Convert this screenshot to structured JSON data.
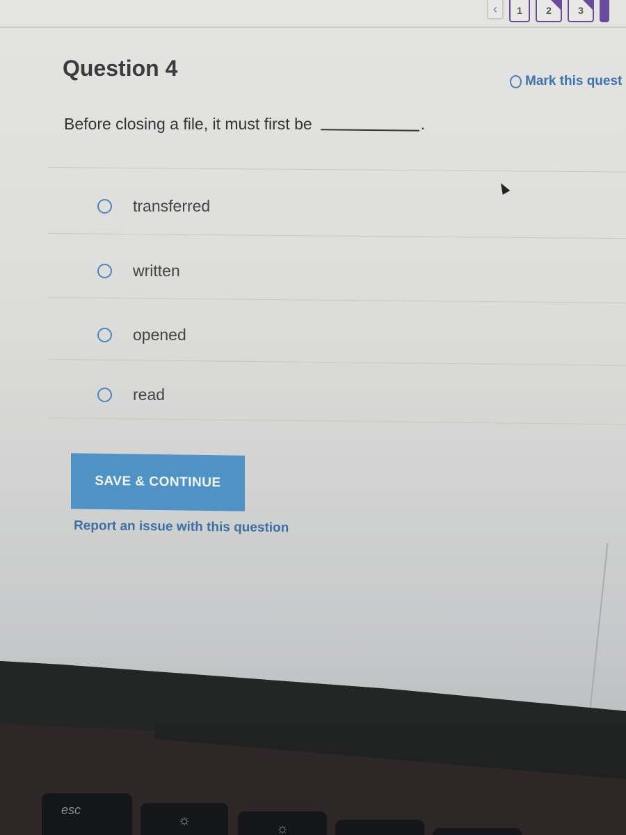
{
  "header": {
    "nav": {
      "prev_icon": "chevron-left-icon",
      "prev_glyph": "‹",
      "question_numbers": [
        "1",
        "2",
        "3"
      ]
    },
    "mark_question_label": "Mark this quest",
    "mark_question_checked": false
  },
  "question": {
    "title": "Question 4",
    "prompt": "Before closing a file, it must first be",
    "prompt_end": ".",
    "options": [
      {
        "label": "transferred",
        "selected": false
      },
      {
        "label": "written",
        "selected": false
      },
      {
        "label": "opened",
        "selected": false
      },
      {
        "label": "read",
        "selected": false
      }
    ]
  },
  "actions": {
    "save_label": "SAVE & CONTINUE",
    "report_label": "Report an issue with this question"
  },
  "keyboard": {
    "esc_label": "esc",
    "brightness_down_glyph": "☼",
    "brightness_up_glyph": "☼"
  },
  "colors": {
    "accent_blue": "#4f93c6",
    "link_blue": "#3c6fa4",
    "nav_purple": "#6a4a9a"
  }
}
